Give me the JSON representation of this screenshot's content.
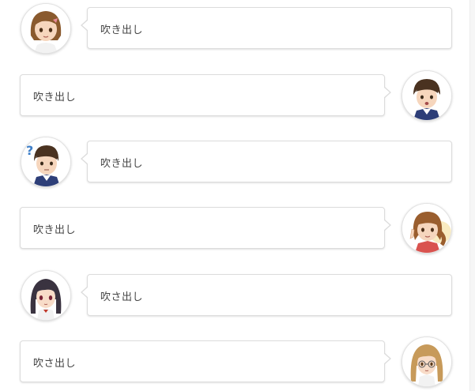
{
  "colors": {
    "bubble_border": "#dcdcdc",
    "text": "#444444",
    "background": "#ffffff"
  },
  "messages": [
    {
      "side": "left",
      "avatar": "woman-brown-hair-avatar-icon",
      "text": "吹き出し"
    },
    {
      "side": "right",
      "avatar": "man-surprised-avatar-icon",
      "text": "吹き出し"
    },
    {
      "side": "left",
      "avatar": "man-question-mark-avatar-icon",
      "text": "吹き出し"
    },
    {
      "side": "right",
      "avatar": "woman-pointing-avatar-icon",
      "text": "吹き出し"
    },
    {
      "side": "left",
      "avatar": "girl-dark-hair-avatar-icon",
      "text": "吹さ出し"
    },
    {
      "side": "right",
      "avatar": "woman-blonde-avatar-icon",
      "text": "吹さ出し"
    }
  ]
}
